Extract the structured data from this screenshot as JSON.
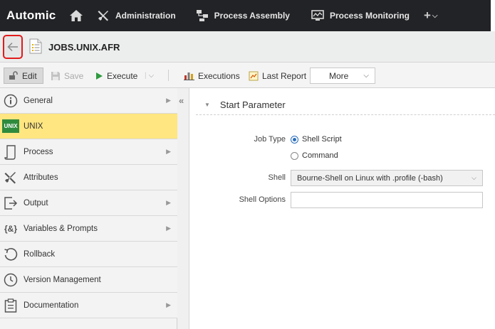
{
  "topnav": {
    "brand": "Automic",
    "items": [
      {
        "label": "Administration",
        "icon": "tools-icon"
      },
      {
        "label": "Process Assembly",
        "icon": "process-assembly-icon"
      },
      {
        "label": "Process Monitoring",
        "icon": "monitor-icon"
      }
    ],
    "plus": "+"
  },
  "titlebar": {
    "title": "JOBS.UNIX.AFR"
  },
  "toolbar": {
    "edit": "Edit",
    "save": "Save",
    "execute": "Execute",
    "executions": "Executions",
    "last_report": "Last Report",
    "more": "More"
  },
  "sidebar": {
    "items": [
      {
        "label": "General",
        "icon": "info-icon",
        "arrow": true
      },
      {
        "label": "UNIX",
        "icon": "unix-icon",
        "arrow": false,
        "badge": "UNIX"
      },
      {
        "label": "Process",
        "icon": "script-icon",
        "arrow": true
      },
      {
        "label": "Attributes",
        "icon": "wrench-icon",
        "arrow": false
      },
      {
        "label": "Output",
        "icon": "output-icon",
        "arrow": true
      },
      {
        "label": "Variables & Prompts",
        "icon": "variables-icon",
        "arrow": true,
        "icon_text": "{&}"
      },
      {
        "label": "Rollback",
        "icon": "rollback-icon",
        "arrow": false
      },
      {
        "label": "Version Management",
        "icon": "clock-icon",
        "arrow": false
      },
      {
        "label": "Documentation",
        "icon": "clipboard-icon",
        "arrow": true
      }
    ]
  },
  "main": {
    "section_title": "Start Parameter",
    "job_type_label": "Job Type",
    "job_type_options": [
      "Shell Script",
      "Command"
    ],
    "job_type_selected": "Shell Script",
    "shell_label": "Shell",
    "shell_value": "Bourne-Shell on Linux with .profile (-bash)",
    "shell_options_label": "Shell Options",
    "shell_options_value": ""
  },
  "colors": {
    "topnav_bg": "#222326",
    "active_item": "#ffe680",
    "highlight_border": "#e21b1b",
    "unix_badge": "#2e8b3e"
  }
}
